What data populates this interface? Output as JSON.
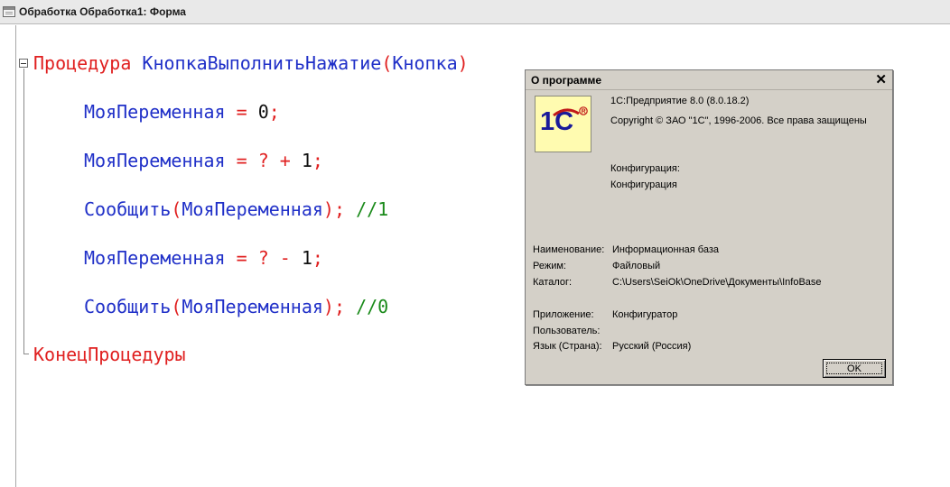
{
  "window": {
    "title": "Обработка Обработка1: Форма"
  },
  "code": {
    "line1": {
      "keyword": "Процедура",
      "name": "КнопкаВыполнитьНажатие",
      "open": "(",
      "param": "Кнопка",
      "close": ")"
    },
    "line2": {
      "var": "МояПеременная",
      "eq": "=",
      "val": "0",
      "semi": ";"
    },
    "line3": {
      "var": "МояПеременная",
      "eq": "=",
      "q": "?",
      "plus": "+",
      "val": "1",
      "semi": ";"
    },
    "line4": {
      "func": "Сообщить",
      "open": "(",
      "arg": "МояПеременная",
      "close": ")",
      "semi": ";",
      "comment": "//1"
    },
    "line5": {
      "var": "МояПеременная",
      "eq": "=",
      "q": "?",
      "minus": "-",
      "val": "1",
      "semi": ";"
    },
    "line6": {
      "func": "Сообщить",
      "open": "(",
      "arg": "МояПеременная",
      "close": ")",
      "semi": ";",
      "comment": "//0"
    },
    "line7": {
      "keyword": "КонецПроцедуры"
    }
  },
  "about_dialog": {
    "title": "О программе",
    "product": "1С:Предприятие 8.0 (8.0.18.2)",
    "copyright": "Copyright © ЗАО \"1С\", 1996-2006. Все права защищены",
    "configuration_label": "Конфигурация:",
    "configuration_value": "Конфигурация",
    "name_label": "Наименование:",
    "name_value": "Информационная база",
    "mode_label": "Режим:",
    "mode_value": "Файловый",
    "catalog_label": "Каталог:",
    "catalog_value": "C:\\Users\\SeiOk\\OneDrive\\Документы\\InfoBase",
    "application_label": "Приложение:",
    "application_value": "Конфигуратор",
    "user_label": "Пользователь:",
    "user_value": "",
    "language_label": "Язык (Страна):",
    "language_value": "Русский (Россия)",
    "ok_label": "OK",
    "logo_text": "1С"
  },
  "colors": {
    "keyword": "#e02020",
    "identifier": "#2030c8",
    "comment": "#1a8a1a",
    "dialog_bg": "#d4d0c8"
  }
}
